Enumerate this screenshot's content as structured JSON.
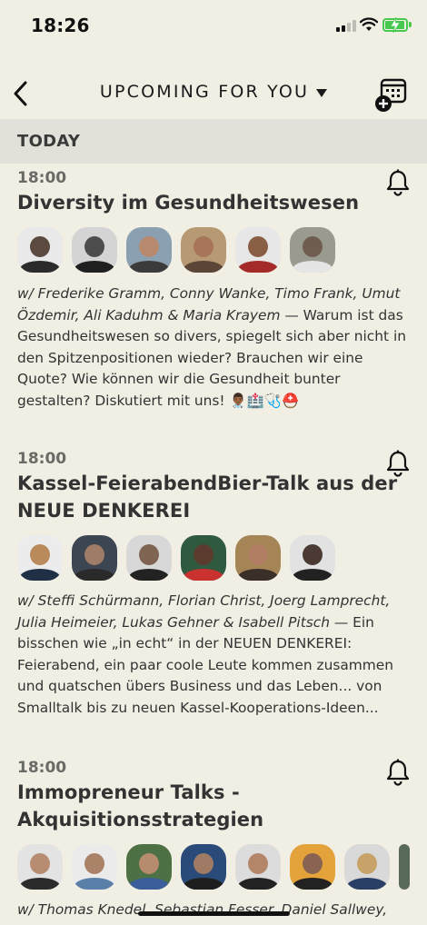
{
  "status_bar": {
    "time": "18:26"
  },
  "nav": {
    "title": "UPCOMING FOR YOU"
  },
  "section": {
    "title": "TODAY"
  },
  "events": [
    {
      "time": "18:00",
      "title_lines": [
        "Diversity im Gesundheitswesen"
      ],
      "hosts": "w/ Frederike Gramm, Conny Wanke, Timo Frank, Umut Özdemir, Ali Kaduhm & Maria Krayem",
      "description": " — Warum ist das Gesundheitswesen so divers, spiegelt sich aber nicht in den Spitzenpositionen wieder? Brauchen wir eine Quote? Wie können wir die Gesundheit bunter gestalten? Diskutiert mit uns! 👨🏾‍⚕️🏥🩺⛑️"
    },
    {
      "time": "18:00",
      "title_lines": [
        "Kassel-FeierabendBier-Talk aus der",
        "NEUE DENKEREI"
      ],
      "hosts": "w/ Steffi Schürmann, Florian Christ, Joerg Lamprecht, Julia Heimeier, Lukas Gehner & Isabell Pitsch",
      "description": " — Ein bisschen wie „in echt“ in der NEUEN DENKEREI: Feierabend, ein paar coole Leute kommen zusammen und quatschen übers Business und das Leben... von Smalltalk bis zu neuen Kassel-Kooperations-Ideen..."
    },
    {
      "time": "18:00",
      "title_lines": [
        "Immopreneur Talks -",
        "Akquisitionsstrategien"
      ],
      "hosts": "w/ Thomas Knedel, Sebastian Fesser, Daniel Sallwey,",
      "description": ""
    }
  ]
}
